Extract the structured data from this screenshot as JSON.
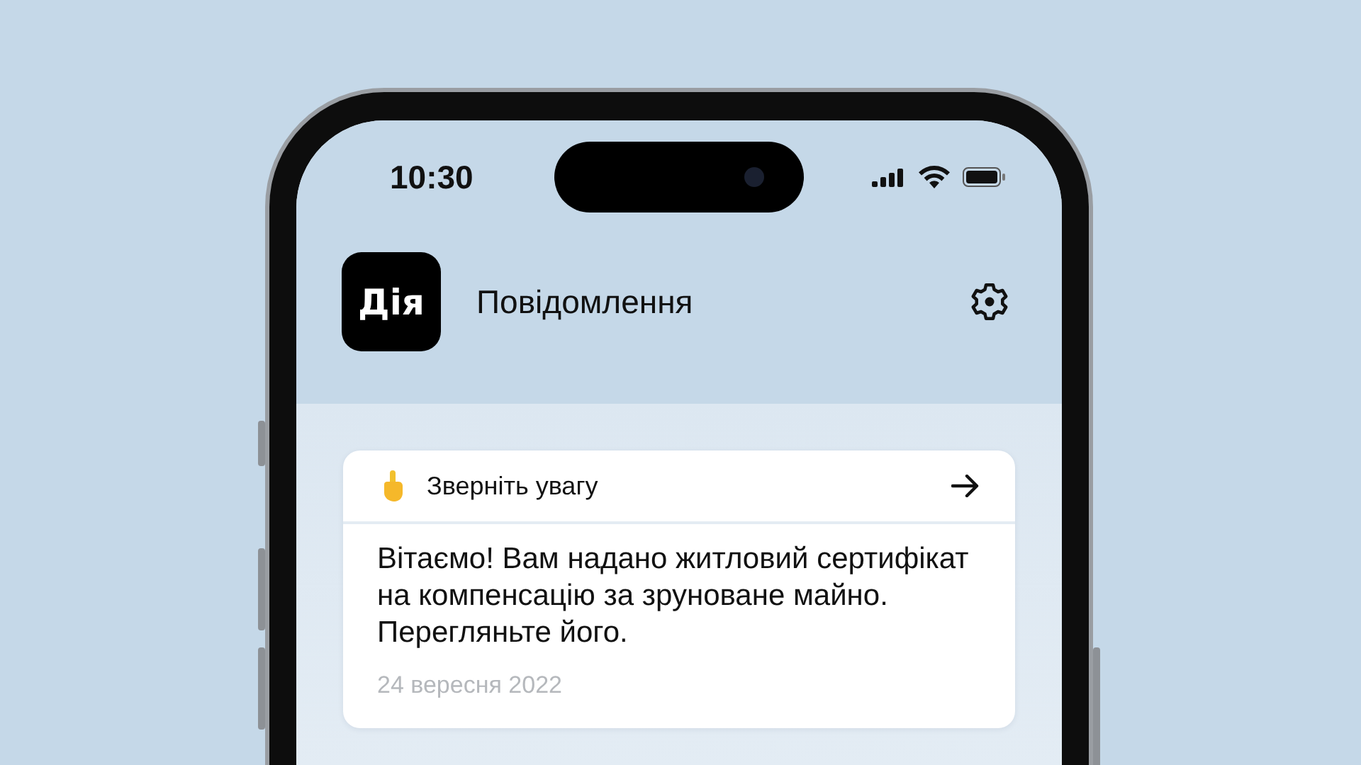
{
  "status_bar": {
    "time": "10:30"
  },
  "header": {
    "logo": "Дія",
    "title": "Повідомлення"
  },
  "notifications": [
    {
      "label": "Зверніть увагу",
      "message": "Вітаємо! Вам надано житловий сертифікат на компенсацію за зруноване майно. Перегляньте його.",
      "date": "24 вересня 2022"
    }
  ]
}
